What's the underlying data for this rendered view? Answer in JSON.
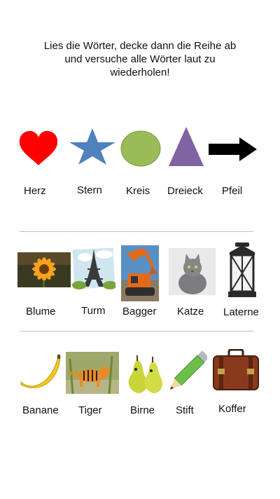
{
  "instructions": {
    "line1": "Lies die Wörter, decke dann die Reihe ab",
    "line2": "und versuche alle Wörter laut zu",
    "line3": "wiederholen!"
  },
  "rows": [
    {
      "words": [
        "Herz",
        "Stern",
        "Kreis",
        "Dreieck",
        "Pfeil"
      ],
      "icons": [
        "heart-icon",
        "star-icon",
        "circle-icon",
        "triangle-icon",
        "arrow-icon"
      ]
    },
    {
      "words": [
        "Blume",
        "Turm",
        "Bagger",
        "Katze",
        "Laterne"
      ],
      "icons": [
        "flower-image",
        "eiffel-tower-image",
        "excavator-image",
        "cat-image",
        "lantern-image"
      ]
    },
    {
      "words": [
        "Banane",
        "Tiger",
        "Birne",
        "Stift",
        "Koffer"
      ],
      "icons": [
        "banana-image",
        "tiger-image",
        "pears-image",
        "pencil-image",
        "suitcase-image"
      ]
    }
  ],
  "colors": {
    "heart": "#ff0000",
    "star": "#4f81bd",
    "circle": "#9bbb59",
    "triangle": "#8064a2",
    "arrow": "#000000",
    "divider": "#a9c7cc"
  }
}
